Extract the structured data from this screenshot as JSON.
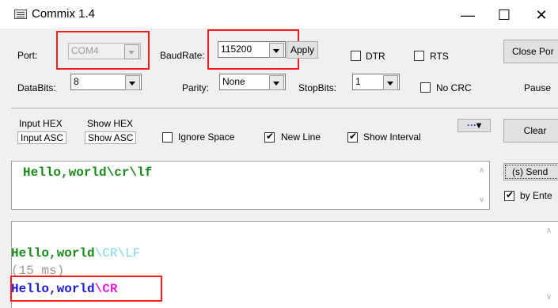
{
  "window": {
    "title": "Commix 1.4",
    "minimize": "—",
    "maximize": "☐",
    "close": "✕"
  },
  "port": {
    "label": "Port:",
    "value": "COM4"
  },
  "baud": {
    "label": "BaudRate:",
    "value": "115200",
    "apply": "Apply"
  },
  "dtr": {
    "label": "DTR",
    "checked": false
  },
  "rts": {
    "label": "RTS",
    "checked": false
  },
  "close_port": "Close Por",
  "databits": {
    "label": "DataBits:",
    "value": "8"
  },
  "parity": {
    "label": "Parity:",
    "value": "None"
  },
  "stopbits": {
    "label": "StopBits:",
    "value": "1"
  },
  "nocrc": {
    "label": "No CRC",
    "checked": false
  },
  "pause": "Pause",
  "input_mode": {
    "hex": "Input HEX",
    "asc": "Input ASC"
  },
  "show_mode": {
    "hex": "Show HEX",
    "asc": "Show ASC"
  },
  "ignore_space": {
    "label": "Ignore Space",
    "checked": false
  },
  "new_line": {
    "label": "New Line",
    "checked": true
  },
  "show_interval": {
    "label": "Show Interval",
    "checked": true
  },
  "more_btn": "···",
  "clear": "Clear",
  "send_box": {
    "text": "Hello,world\\cr\\lf"
  },
  "send_btn": "(s) Send",
  "by_enter": {
    "label": "by Ente",
    "checked": true
  },
  "output": {
    "line1": {
      "text": "Hello,world",
      "escape": "\\CR\\LF"
    },
    "interval": "(15 ms)",
    "line2": {
      "text": "Hello,world",
      "escape": "\\CR"
    }
  },
  "colors": {
    "accent_red": "#ff1a1a",
    "send_green": "#1a8a1a",
    "escape_cyan": "#7fd6e8",
    "escape_magenta": "#e020e0",
    "out_blue": "#1a1adc"
  }
}
